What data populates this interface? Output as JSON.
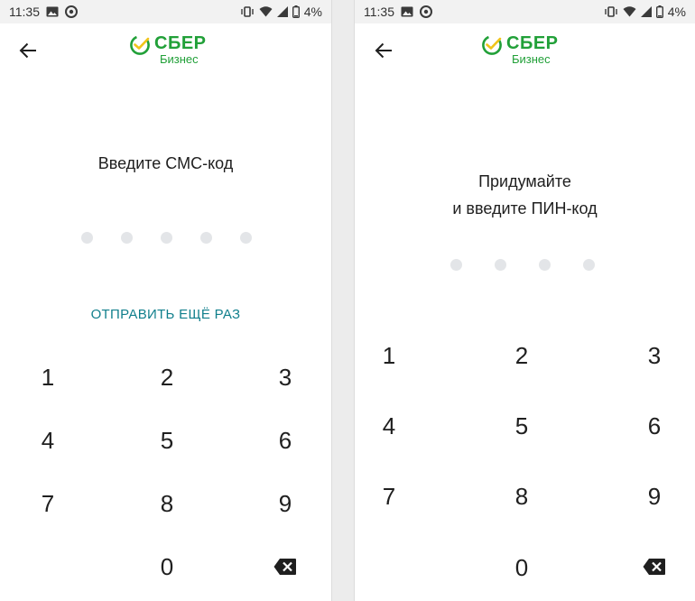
{
  "status_bar": {
    "time": "11:35",
    "battery": "4%",
    "icons": [
      "image-icon",
      "sync-icon",
      "vibrate-icon",
      "wifi-icon",
      "signal-icon",
      "battery-icon"
    ]
  },
  "logo": {
    "brand": "СБЕР",
    "subtitle": "Бизнес",
    "brand_color": "#21a038"
  },
  "left_screen": {
    "prompt": "Введите СМС-код",
    "resend_label": "ОТПРАВИТЬ ЕЩЁ РАЗ",
    "code_length": 5,
    "entered": 0,
    "keys": [
      "1",
      "2",
      "3",
      "4",
      "5",
      "6",
      "7",
      "8",
      "9",
      "0"
    ]
  },
  "right_screen": {
    "prompt_line1": "Придумайте",
    "prompt_line2": "и введите ПИН-код",
    "pin_length": 4,
    "entered": 0,
    "keys": [
      "1",
      "2",
      "3",
      "4",
      "5",
      "6",
      "7",
      "8",
      "9",
      "0"
    ]
  },
  "colors": {
    "accent": "#107f8c",
    "dot_empty": "#e3e5e8",
    "text": "#1f1f1f"
  }
}
